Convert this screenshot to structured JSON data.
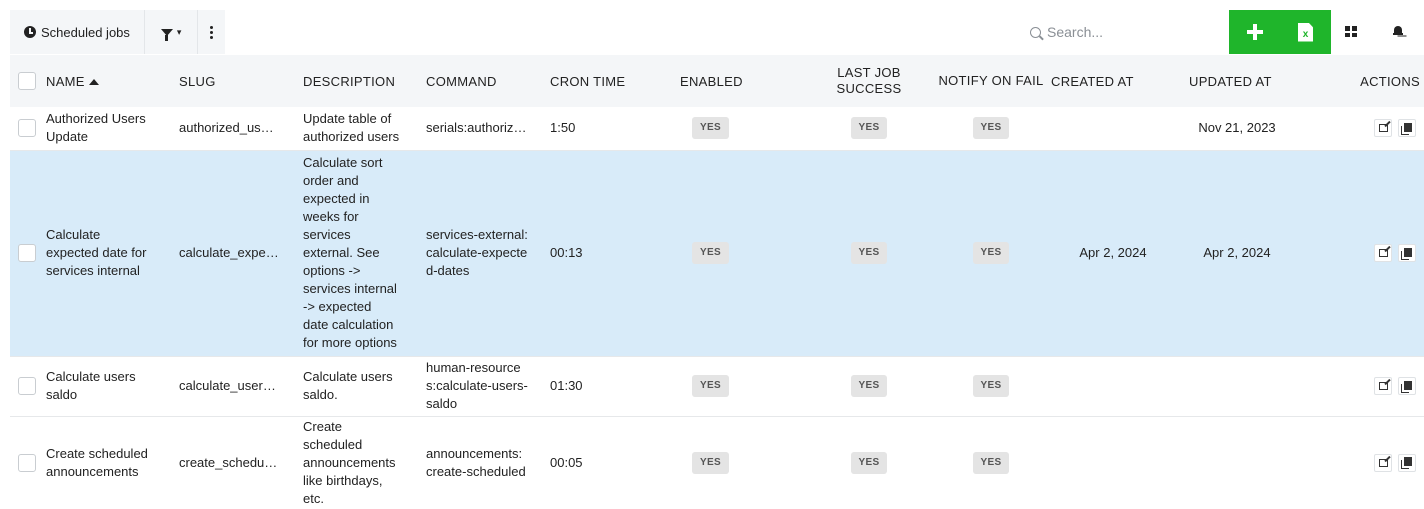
{
  "toolbar": {
    "tab_label": "Scheduled jobs",
    "search_placeholder": "Search..."
  },
  "table": {
    "columns": {
      "name": "NAME",
      "slug": "SLUG",
      "description": "DESCRIPTION",
      "command": "COMMAND",
      "cron_time": "CRON TIME",
      "enabled": "ENABLED",
      "last_job_success": "LAST JOB SUCCESS",
      "notify_on_fail": "NOTIFY ON FAIL",
      "created_at": "CREATED AT",
      "updated_at": "UPDATED AT",
      "actions": "ACTIONS"
    },
    "sort": {
      "column": "name",
      "direction": "ascending"
    },
    "rows": [
      {
        "name": "Authorized Users Update",
        "slug": "authorized_users_update",
        "description": "Update table of authorized users",
        "command": "serials:authorized-users-update",
        "cron_time": "1:50",
        "enabled": "YES",
        "last_job_success": "YES",
        "notify_on_fail": "YES",
        "created_at": "",
        "updated_at": "Nov 21, 2023",
        "selected": false
      },
      {
        "name": "Calculate expected date for services internal",
        "slug": "calculate_expected_dates",
        "description": "Calculate sort order and expected in weeks for services external. See options -> services internal -> expected date calculation for more options",
        "command": "services-external:calculate-expected-dates",
        "cron_time": "00:13",
        "enabled": "YES",
        "last_job_success": "YES",
        "notify_on_fail": "YES",
        "created_at": "Apr 2, 2024",
        "updated_at": "Apr 2, 2024",
        "selected": true
      },
      {
        "name": "Calculate users saldo",
        "slug": "calculate_users_saldo",
        "description": "Calculate users saldo.",
        "command": "human-resources:calculate-users-saldo",
        "cron_time": "01:30",
        "enabled": "YES",
        "last_job_success": "YES",
        "notify_on_fail": "YES",
        "created_at": "",
        "updated_at": "",
        "selected": false
      },
      {
        "name": "Create scheduled announcements",
        "slug": "create_scheduled_announcements",
        "description": "Create scheduled announcements like birthdays, etc.",
        "command": "announcements:create-scheduled",
        "cron_time": "00:05",
        "enabled": "YES",
        "last_job_success": "YES",
        "notify_on_fail": "YES",
        "created_at": "",
        "updated_at": "",
        "selected": false
      }
    ]
  },
  "icons": {
    "tab": "clock-icon",
    "filter": "filter-icon",
    "more": "kebab-menu-icon",
    "search": "search-icon",
    "add": "plus-icon",
    "export": "excel-export-icon",
    "layout": "grid-view-icon",
    "notifications": "bell-icon",
    "edit": "edit-icon",
    "copy": "copy-icon"
  },
  "colors": {
    "accent_green": "#1fb52b",
    "selected_row": "#d8ebf9",
    "header_bg": "#f4f6f8",
    "badge_bg": "#e4e4e4"
  }
}
